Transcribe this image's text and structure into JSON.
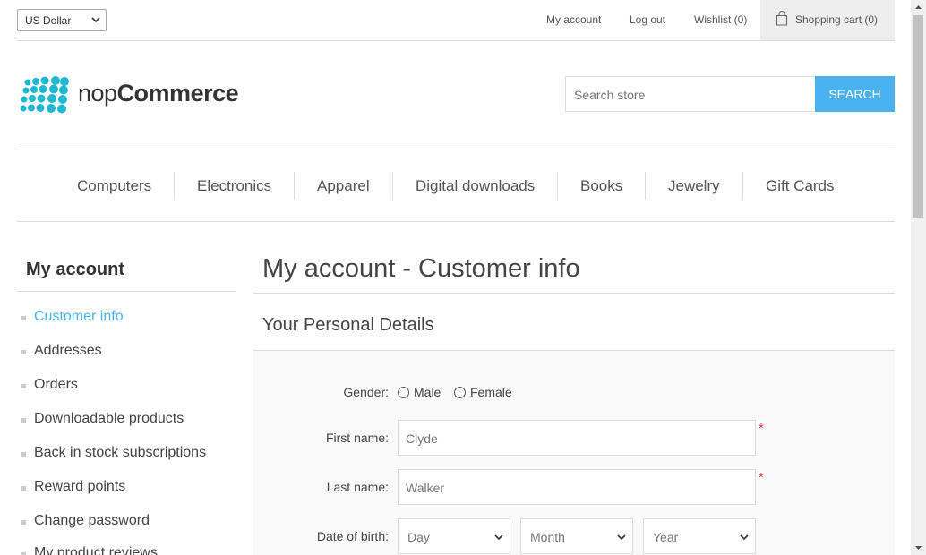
{
  "header": {
    "currency": "US Dollar",
    "links": {
      "my_account": "My account",
      "log_out": "Log out",
      "wishlist": "Wishlist (0)",
      "shopping_cart": "Shopping cart (0)"
    }
  },
  "logo": {
    "part1": "nop",
    "part2": "Commerce"
  },
  "search": {
    "placeholder": "Search store",
    "button": "SEARCH"
  },
  "menu": {
    "items": [
      "Computers",
      "Electronics",
      "Apparel",
      "Digital downloads",
      "Books",
      "Jewelry",
      "Gift Cards"
    ]
  },
  "sidebar": {
    "title": "My account",
    "items": [
      {
        "label": "Customer info",
        "active": true
      },
      {
        "label": "Addresses"
      },
      {
        "label": "Orders"
      },
      {
        "label": "Downloadable products"
      },
      {
        "label": "Back in stock subscriptions"
      },
      {
        "label": "Reward points"
      },
      {
        "label": "Change password"
      },
      {
        "label": "My product reviews"
      }
    ]
  },
  "page": {
    "title": "My account - Customer info",
    "section_title": "Your Personal Details"
  },
  "form": {
    "gender_label": "Gender:",
    "gender_male": "Male",
    "gender_female": "Female",
    "first_name_label": "First name:",
    "first_name_value": "Clyde",
    "last_name_label": "Last name:",
    "last_name_value": "Walker",
    "dob_label": "Date of birth:",
    "dob_day": "Day",
    "dob_month": "Month",
    "dob_year": "Year",
    "required_mark": "*"
  },
  "colors": {
    "accent": "#4ab2f1",
    "required": "#e4434b"
  }
}
